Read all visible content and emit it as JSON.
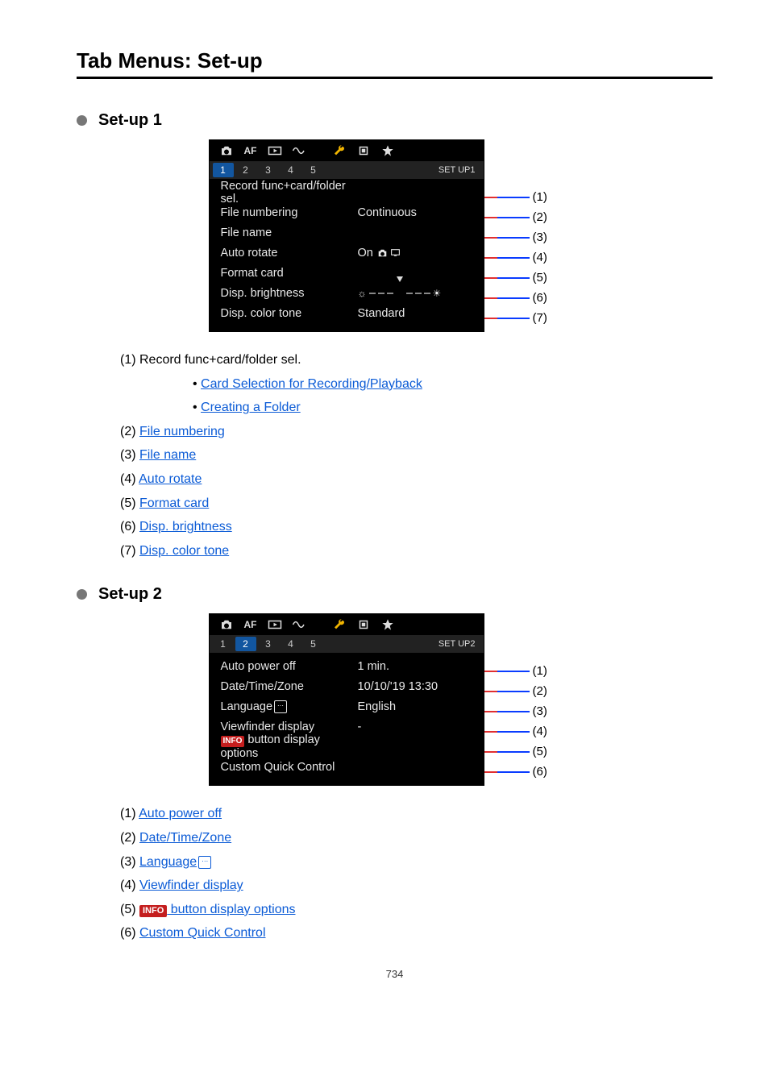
{
  "page_title": "Tab Menus: Set-up",
  "page_number": "734",
  "section1": {
    "heading": "Set-up 1",
    "tab_bar": {
      "af": "AF",
      "title": "SET UP1"
    },
    "sub_tabs": [
      "1",
      "2",
      "3",
      "4",
      "5"
    ],
    "menu": [
      {
        "label": "Record func+card/folder sel.",
        "value": "",
        "anno": "(1)"
      },
      {
        "label": "File numbering",
        "value": "Continuous",
        "anno": "(2)"
      },
      {
        "label": "File name",
        "value": "",
        "anno": "(3)"
      },
      {
        "label": "Auto rotate",
        "value": "On",
        "anno": "(4)",
        "auto_rotate": true
      },
      {
        "label": "Format card",
        "value": "",
        "anno": "(5)"
      },
      {
        "label": "Disp. brightness",
        "value": "",
        "anno": "(6)",
        "brightness": true
      },
      {
        "label": "Disp. color tone",
        "value": "Standard",
        "anno": "(7)"
      }
    ],
    "items": [
      {
        "num": "(1)",
        "text": "Record func+card/folder sel.",
        "link": false,
        "sub": [
          {
            "text": "Card Selection for Recording/Playback"
          },
          {
            "text": "Creating a Folder"
          }
        ]
      },
      {
        "num": "(2)",
        "text": "File numbering",
        "link": true
      },
      {
        "num": "(3)",
        "text": "File name",
        "link": true
      },
      {
        "num": "(4)",
        "text": "Auto rotate",
        "link": true
      },
      {
        "num": "(5)",
        "text": "Format card",
        "link": true
      },
      {
        "num": "(6)",
        "text": "Disp. brightness",
        "link": true
      },
      {
        "num": "(7)",
        "text": "Disp. color tone",
        "link": true
      }
    ]
  },
  "section2": {
    "heading": "Set-up 2",
    "tab_bar": {
      "af": "AF",
      "title": "SET UP2"
    },
    "sub_tabs": [
      "1",
      "2",
      "3",
      "4",
      "5"
    ],
    "menu": [
      {
        "label": "Auto power off",
        "value": "1 min.",
        "anno": "(1)"
      },
      {
        "label": "Date/Time/Zone",
        "value": "10/10/'19 13:30",
        "anno": "(2)"
      },
      {
        "label": "Language",
        "value": "English",
        "anno": "(3)",
        "lang_glyph": true
      },
      {
        "label": "Viewfinder display",
        "value": "-",
        "anno": "(4)"
      },
      {
        "label": " button display options",
        "value": "",
        "anno": "(5)",
        "info_prefix": true
      },
      {
        "label": "Custom Quick Control",
        "value": "",
        "anno": "(6)"
      }
    ],
    "items": [
      {
        "num": "(1)",
        "text": "Auto power off",
        "link": true
      },
      {
        "num": "(2)",
        "text": "Date/Time/Zone",
        "link": true
      },
      {
        "num": "(3)",
        "text": "Language",
        "link": true,
        "lang_glyph": true
      },
      {
        "num": "(4)",
        "text": "Viewfinder display",
        "link": true
      },
      {
        "num": "(5)",
        "text": " button display options",
        "link": true,
        "info_prefix": true
      },
      {
        "num": "(6)",
        "text": "Custom Quick Control",
        "link": true
      }
    ],
    "info_badge": "INFO"
  }
}
